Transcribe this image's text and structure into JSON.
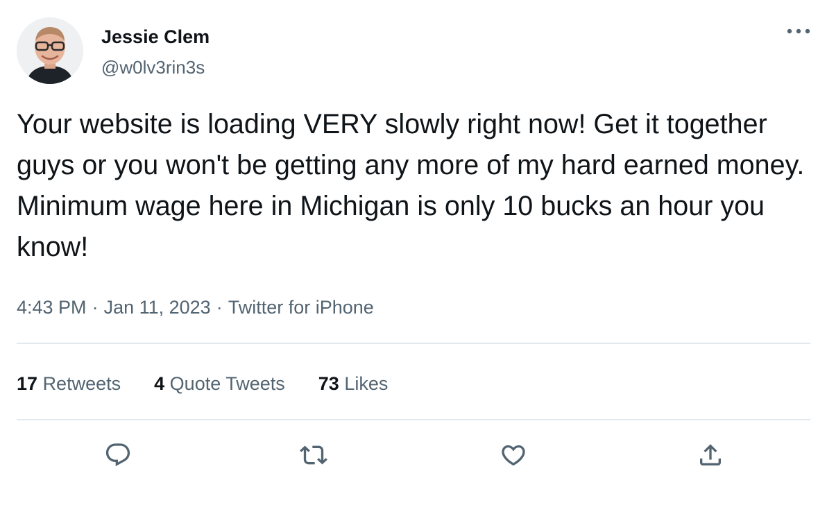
{
  "tweet": {
    "author": {
      "display_name": "Jessie Clem",
      "handle": "@w0lv3rin3s"
    },
    "text": "Your website is loading VERY slowly right now! Get it together guys or you won't be getting any more of my hard earned money. Minimum wage here in Michigan is only 10 bucks an hour you know!",
    "time": "4:43 PM",
    "date": "Jan 11, 2023",
    "source": "Twitter for iPhone",
    "separator": "·",
    "stats": {
      "retweets": {
        "count": "17",
        "label": "Retweets"
      },
      "quote_tweets": {
        "count": "4",
        "label": "Quote Tweets"
      },
      "likes": {
        "count": "73",
        "label": "Likes"
      }
    }
  },
  "icons": {
    "more": "more-horizontal-icon",
    "reply": "reply-icon",
    "retweet": "retweet-icon",
    "like": "heart-icon",
    "share": "share-icon"
  },
  "colors": {
    "text_primary": "#0f1419",
    "text_secondary": "#536471",
    "divider": "#e3e8ec",
    "background": "#ffffff"
  }
}
